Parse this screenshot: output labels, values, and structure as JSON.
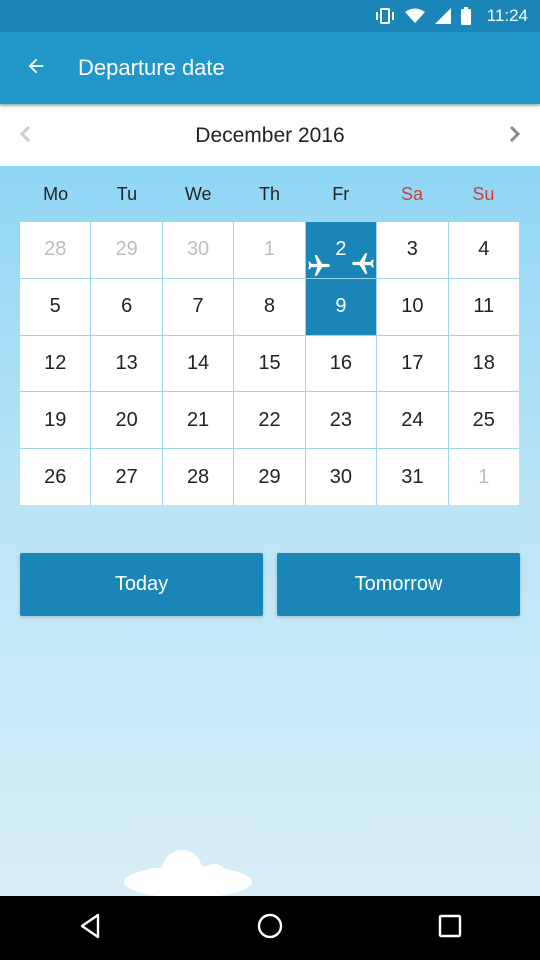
{
  "status_bar": {
    "time": "11:24"
  },
  "app_bar": {
    "title": "Departure date"
  },
  "month_bar": {
    "label": "December 2016"
  },
  "weekdays": [
    {
      "label": "Mo",
      "weekend": false
    },
    {
      "label": "Tu",
      "weekend": false
    },
    {
      "label": "We",
      "weekend": false
    },
    {
      "label": "Th",
      "weekend": false
    },
    {
      "label": "Fr",
      "weekend": false
    },
    {
      "label": "Sa",
      "weekend": true
    },
    {
      "label": "Su",
      "weekend": true
    }
  ],
  "days": [
    {
      "label": "28",
      "muted": true
    },
    {
      "label": "29",
      "muted": true
    },
    {
      "label": "30",
      "muted": true
    },
    {
      "label": "1",
      "muted": true
    },
    {
      "label": "2",
      "selected": true,
      "plane": "departure"
    },
    {
      "label": "3"
    },
    {
      "label": "4"
    },
    {
      "label": "5"
    },
    {
      "label": "6"
    },
    {
      "label": "7"
    },
    {
      "label": "8"
    },
    {
      "label": "9",
      "selected": true,
      "plane": "arrival"
    },
    {
      "label": "10"
    },
    {
      "label": "11"
    },
    {
      "label": "12"
    },
    {
      "label": "13"
    },
    {
      "label": "14"
    },
    {
      "label": "15"
    },
    {
      "label": "16"
    },
    {
      "label": "17"
    },
    {
      "label": "18"
    },
    {
      "label": "19"
    },
    {
      "label": "20"
    },
    {
      "label": "21"
    },
    {
      "label": "22"
    },
    {
      "label": "23"
    },
    {
      "label": "24"
    },
    {
      "label": "25"
    },
    {
      "label": "26"
    },
    {
      "label": "27"
    },
    {
      "label": "28"
    },
    {
      "label": "29"
    },
    {
      "label": "30"
    },
    {
      "label": "31"
    },
    {
      "label": "1",
      "muted": true
    }
  ],
  "buttons": {
    "today": "Today",
    "tomorrow": "Tomorrow"
  },
  "icons": {
    "back": "arrow-back-icon",
    "prev": "chevron-left-icon",
    "next": "chevron-right-icon",
    "plane_departure": "plane-departure-icon",
    "plane_arrival": "plane-arrival-icon",
    "nav_back": "nav-back-icon",
    "nav_home": "nav-home-icon",
    "nav_recents": "nav-recents-icon"
  },
  "colors": {
    "primary": "#2196c9",
    "primary_dark": "#1a86b8",
    "weekend": "#d23c3c",
    "muted": "#bdbdbd"
  }
}
